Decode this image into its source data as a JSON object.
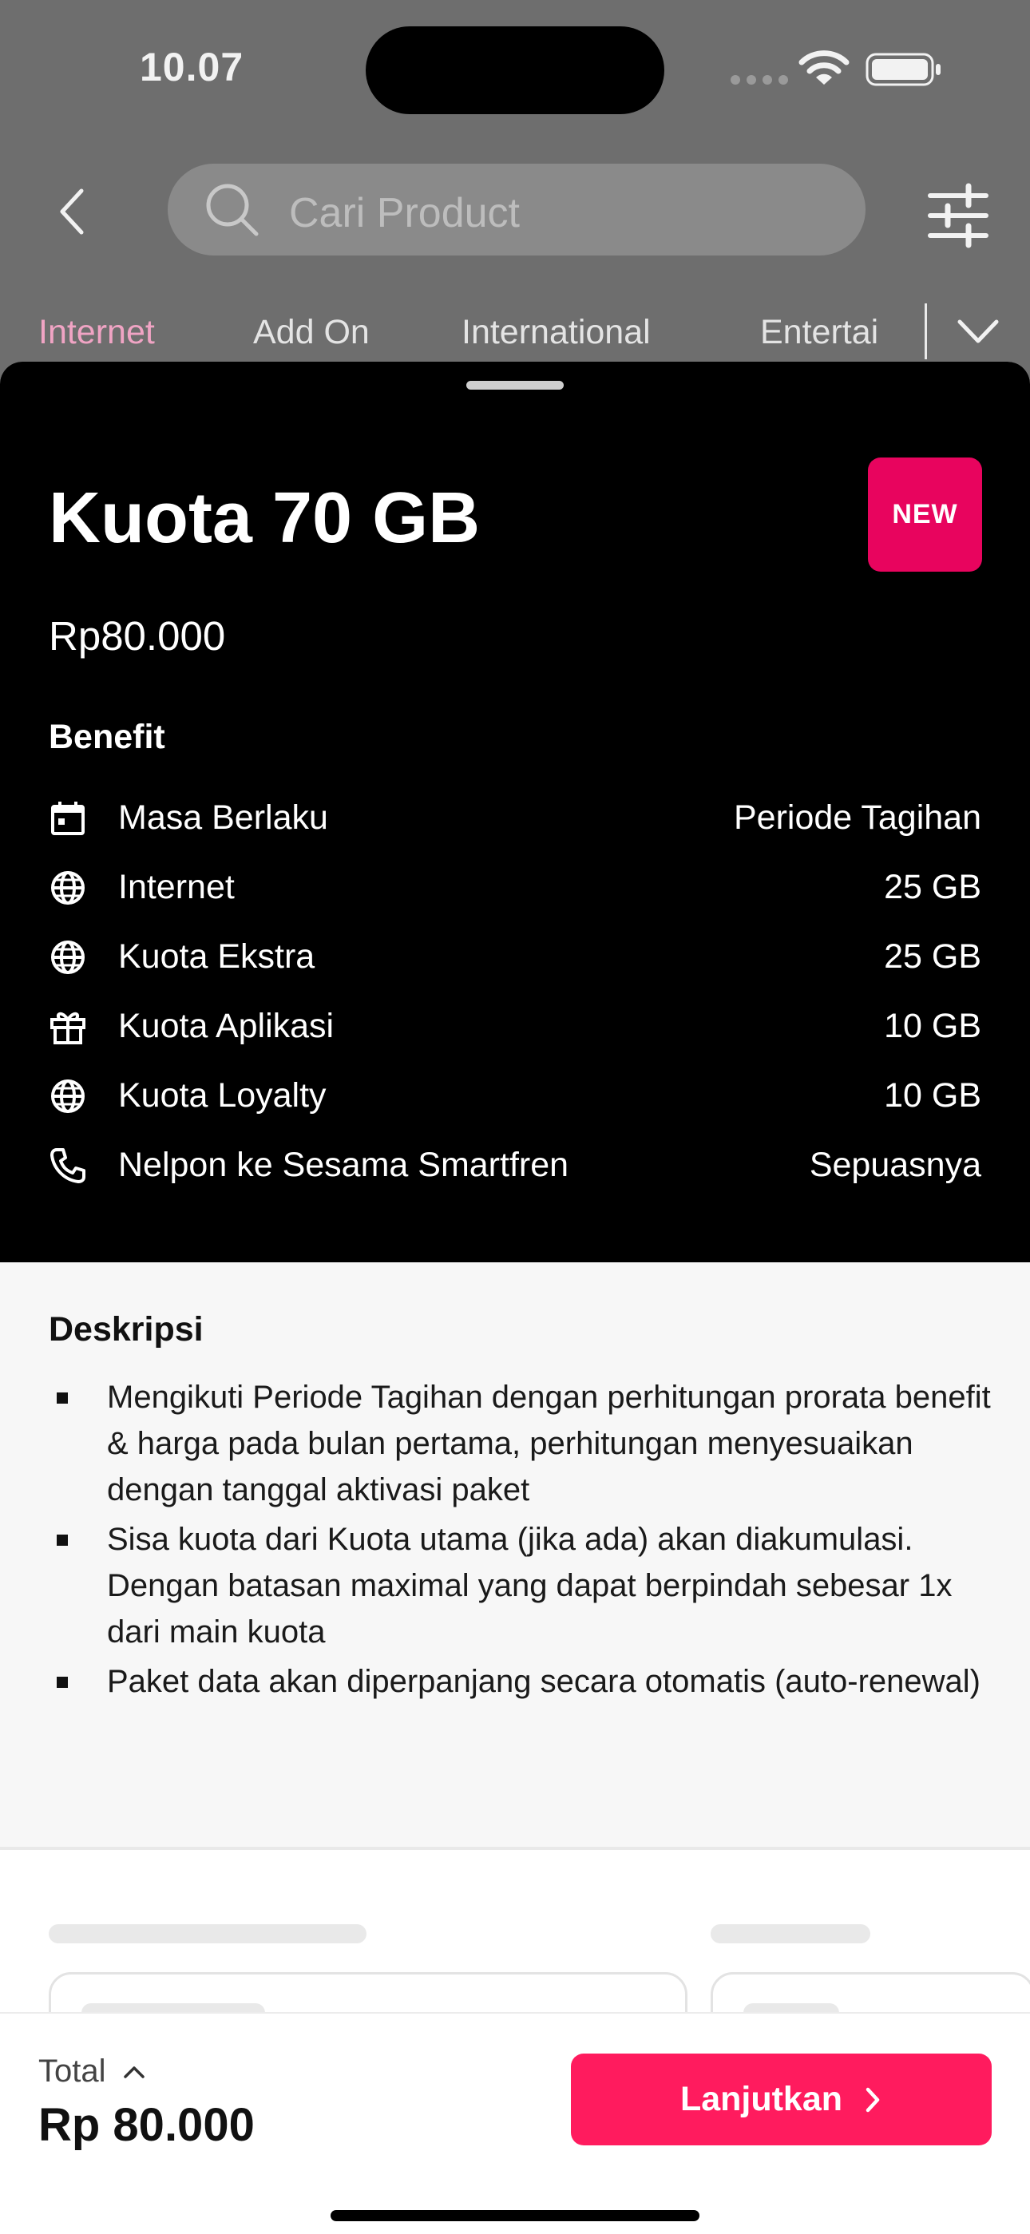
{
  "status_bar": {
    "time": "10.07"
  },
  "header": {
    "search_placeholder": "Cari Product"
  },
  "tabs": [
    {
      "label": "Internet",
      "active": true
    },
    {
      "label": "Add On",
      "active": false
    },
    {
      "label": "International",
      "active": false
    },
    {
      "label": "Entertai",
      "active": false
    }
  ],
  "product": {
    "title": "Kuota 70 GB",
    "badge": "NEW",
    "price": "Rp80.000",
    "benefit_heading": "Benefit",
    "benefits": [
      {
        "icon": "calendar-icon",
        "label": "Masa Berlaku",
        "value": "Periode Tagihan"
      },
      {
        "icon": "globe-icon",
        "label": "Internet",
        "value": "25 GB"
      },
      {
        "icon": "globe-icon",
        "label": "Kuota Ekstra",
        "value": "25 GB"
      },
      {
        "icon": "gift-icon",
        "label": "Kuota Aplikasi",
        "value": "10 GB"
      },
      {
        "icon": "globe-icon",
        "label": "Kuota Loyalty",
        "value": "10 GB"
      },
      {
        "icon": "phone-icon",
        "label": "Nelpon ke Sesama Smartfren",
        "value": "Sepuasnya"
      }
    ]
  },
  "description": {
    "heading": "Deskripsi",
    "items": [
      "Mengikuti Periode Tagihan  dengan perhitungan prorata benefit & harga pada bulan pertama, perhitungan menyesuaikan dengan tanggal aktivasi paket",
      "Sisa kuota dari Kuota utama (jika ada) akan diakumulasi. Dengan batasan maximal yang dapat berpindah sebesar 1x dari main kuota",
      "Paket data akan diperpanjang secara otomatis (auto-renewal)"
    ]
  },
  "footer": {
    "total_label": "Total",
    "total_value": "Rp 80.000",
    "button_label": "Lanjutkan"
  },
  "colors": {
    "accent": "#ff1b5e",
    "badge": "#e8045e",
    "active_tab": "#f0a4c4"
  }
}
